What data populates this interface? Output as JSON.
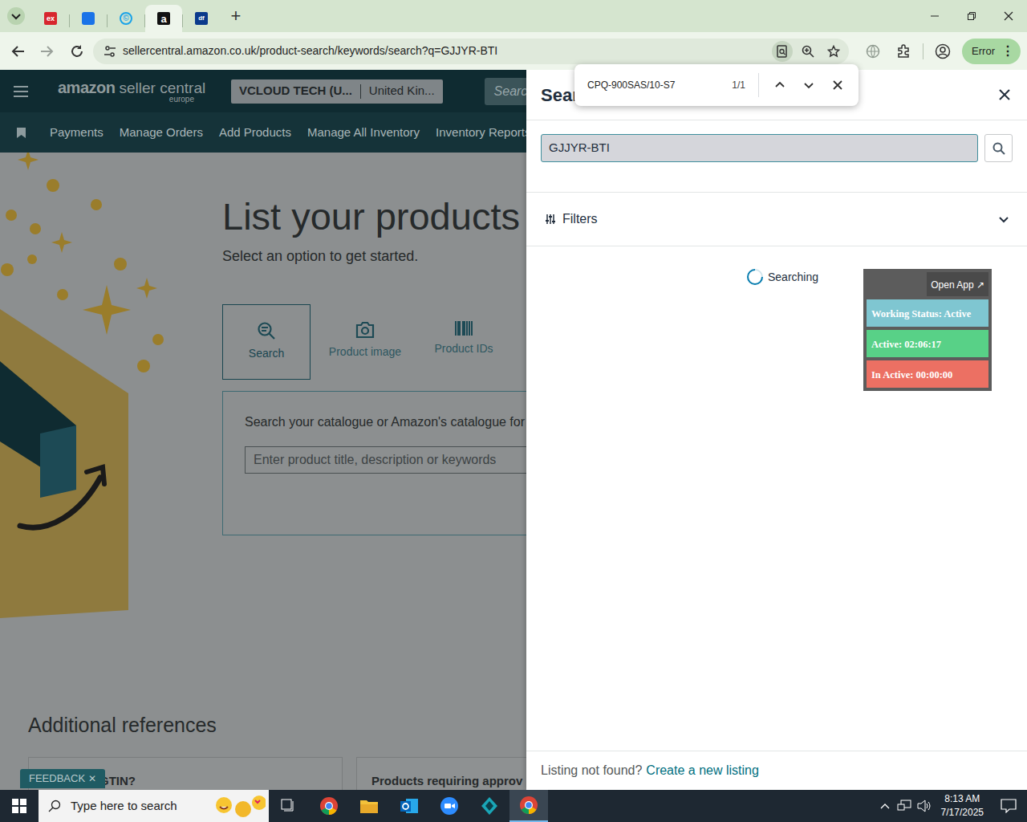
{
  "browser": {
    "tabs": [
      {
        "badge": "ex",
        "kind": "red",
        "selected": false
      },
      {
        "badge": "",
        "kind": "blue",
        "selected": false
      },
      {
        "badge": "©",
        "kind": "cyan",
        "selected": false
      },
      {
        "badge": "a",
        "kind": "amazon",
        "selected": true
      },
      {
        "badge": "df",
        "kind": "navy",
        "selected": false
      }
    ],
    "new_tab": "+",
    "url": "sellercentral.amazon.co.uk/product-search/keywords/search?q=GJJYR-BTI",
    "profile_status": "Error",
    "menu": "⋮"
  },
  "find_bar": {
    "query": "CPQ-900SAS/10-S7",
    "count": "1/1"
  },
  "header": {
    "logo_brand": "amazon",
    "logo_product": "seller central",
    "logo_sub": "europe",
    "account": "VCLOUD TECH (U...",
    "marketplace": "United Kin...",
    "search_placeholder": "Search"
  },
  "nav": [
    "Payments",
    "Manage Orders",
    "Add Products",
    "Manage All Inventory",
    "Inventory Reports"
  ],
  "main": {
    "title": "List your products",
    "subtitle": "Select an option to get started.",
    "options": [
      {
        "label": "Search",
        "selected": true
      },
      {
        "label": "Product image",
        "selected": false
      },
      {
        "label": "Product IDs",
        "selected": false
      }
    ],
    "search_card": {
      "text": "Search your catalogue or Amazon's catalogue for a",
      "placeholder": "Enter product title, description or keywords"
    },
    "references_title": "Additional references",
    "references": [
      "What is a GTIN?",
      "Products requiring approv"
    ]
  },
  "feedback": {
    "label": "FEEDBACK",
    "close": "✕"
  },
  "panel": {
    "title": "Sear",
    "query": "GJJYR-BTI",
    "filters": "Filters",
    "status": "Searching",
    "footer_text": "Listing not found?",
    "footer_link": "Create a new listing"
  },
  "widget": {
    "open_app": "Open App ↗",
    "working_status": "Working Status: Active",
    "active": "Active: 02:06:17",
    "inactive": "In Active: 00:00:00"
  },
  "taskbar": {
    "search_placeholder": "Type here to search",
    "time": "8:13 AM",
    "date": "7/17/2025"
  }
}
